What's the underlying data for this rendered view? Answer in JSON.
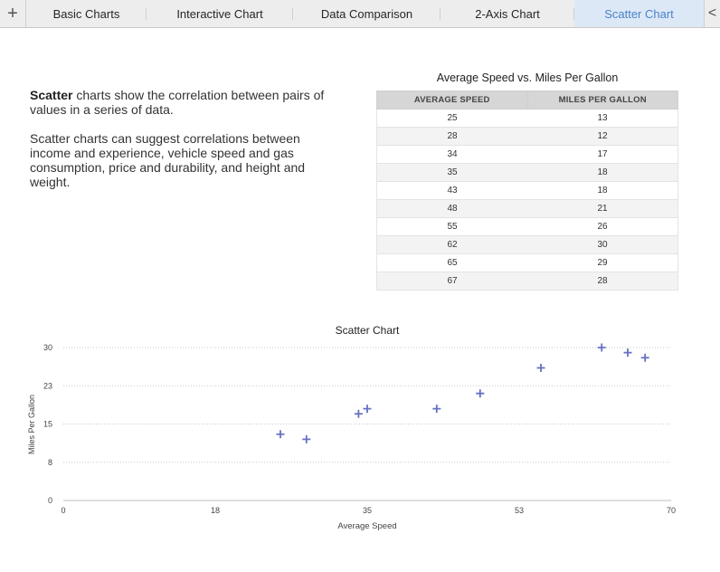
{
  "tabs": {
    "add_label": "+",
    "items": [
      {
        "label": "Basic Charts",
        "active": false
      },
      {
        "label": "Interactive Chart",
        "active": false
      },
      {
        "label": "Data Comparison",
        "active": false
      },
      {
        "label": "2-Axis Chart",
        "active": false
      },
      {
        "label": "Scatter Chart",
        "active": true
      }
    ],
    "scroll_label": "<"
  },
  "description": {
    "p1_bold": "Scatter",
    "p1_rest": " charts show the correlation between pairs of values in a series of data.",
    "p2": "Scatter charts can suggest correlations between income and experience, vehicle speed and gas consumption, price and durability, and height and weight."
  },
  "table": {
    "title": "Average Speed vs. Miles Per Gallon",
    "headers": [
      "AVERAGE SPEED",
      "MILES PER GALLON"
    ],
    "rows": [
      [
        "25",
        "13"
      ],
      [
        "28",
        "12"
      ],
      [
        "34",
        "17"
      ],
      [
        "35",
        "18"
      ],
      [
        "43",
        "18"
      ],
      [
        "48",
        "21"
      ],
      [
        "55",
        "26"
      ],
      [
        "62",
        "30"
      ],
      [
        "65",
        "29"
      ],
      [
        "67",
        "28"
      ]
    ]
  },
  "chart_data": {
    "type": "scatter",
    "title": "Scatter Chart",
    "xlabel": "Average Speed",
    "ylabel": "Miles Per Gallon",
    "xlim": [
      0,
      70
    ],
    "ylim": [
      0,
      30
    ],
    "x_ticks": [
      "0",
      "18",
      "35",
      "53",
      "70"
    ],
    "y_ticks": [
      "0",
      "8",
      "15",
      "23",
      "30"
    ],
    "grid": true,
    "marker_color": "#6670c4",
    "x": [
      25,
      28,
      34,
      35,
      43,
      48,
      55,
      62,
      65,
      67
    ],
    "y": [
      13,
      12,
      17,
      18,
      18,
      21,
      26,
      30,
      29,
      28
    ]
  }
}
